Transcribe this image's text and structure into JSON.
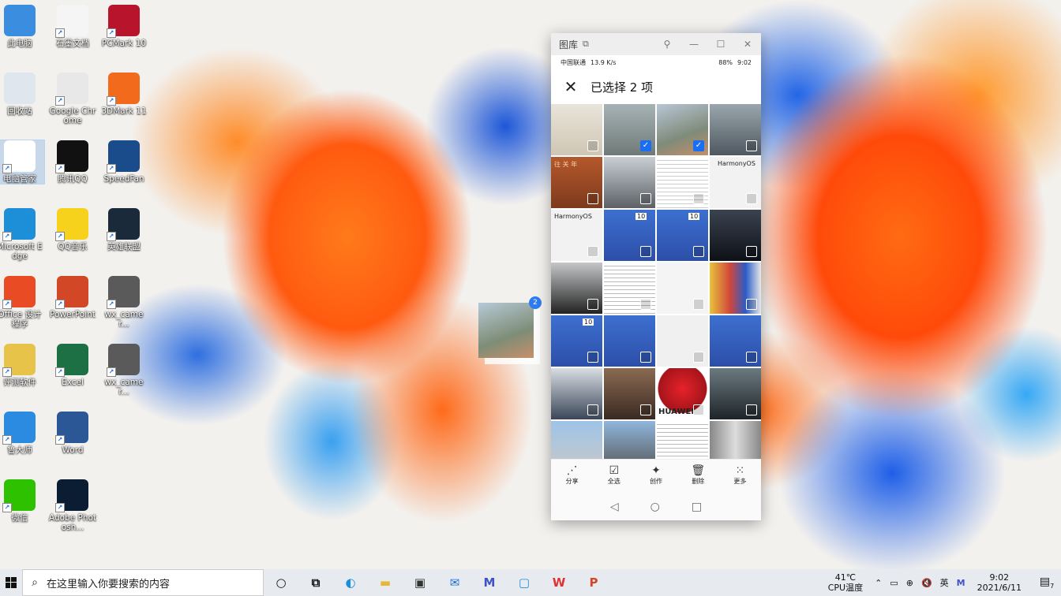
{
  "desktop": {
    "icons": [
      {
        "label": "此电脑",
        "icon": "computer-icon",
        "color": "#3b8de0"
      },
      {
        "label": "石墨文档",
        "icon": "shimo-docs-icon",
        "color": "#f5f5f5"
      },
      {
        "label": "PCMark 10",
        "icon": "pcmark-icon",
        "color": "#b8142b"
      },
      {
        "label": "回收站",
        "icon": "recycle-bin-icon",
        "color": "#dfe6ee"
      },
      {
        "label": "Google Chrome",
        "icon": "chrome-icon",
        "color": "#e8e8e8"
      },
      {
        "label": "3DMark 11",
        "icon": "3dmark-icon",
        "color": "#f26b1d"
      },
      {
        "label": "电脑管家",
        "icon": "pc-manager-icon",
        "color": "#ffffff"
      },
      {
        "label": "腾讯QQ",
        "icon": "qq-icon",
        "color": "#111111"
      },
      {
        "label": "SpeedFan",
        "icon": "speedfan-icon",
        "color": "#1a4b8a"
      },
      {
        "label": "Microsoft Edge",
        "icon": "edge-icon",
        "color": "#1d8fd8"
      },
      {
        "label": "QQ音乐",
        "icon": "qq-music-icon",
        "color": "#f7d21c"
      },
      {
        "label": "英雄联盟",
        "icon": "lol-icon",
        "color": "#1b2a3a"
      },
      {
        "label": "Office 设计 程序",
        "icon": "office-icon",
        "color": "#e94b24"
      },
      {
        "label": "PowerPoint",
        "icon": "powerpoint-icon",
        "color": "#d24726"
      },
      {
        "label": "wx_camer...",
        "icon": "image-file-icon",
        "color": "#5a5a5a"
      },
      {
        "label": "评测软件",
        "icon": "folder-icon",
        "color": "#e8c34a"
      },
      {
        "label": "Excel",
        "icon": "excel-icon",
        "color": "#1d7044"
      },
      {
        "label": "wx_camer...",
        "icon": "image-file-icon",
        "color": "#5a5a5a"
      },
      {
        "label": "鲁大师",
        "icon": "ludashi-icon",
        "color": "#2a8be0"
      },
      {
        "label": "Word",
        "icon": "word-icon",
        "color": "#2b5797"
      },
      {
        "label": "微信",
        "icon": "wechat-icon",
        "color": "#2dc100"
      },
      {
        "label": "Adobe Photosh...",
        "icon": "photoshop-icon",
        "color": "#0b1d33"
      }
    ]
  },
  "gallery_window": {
    "title": "图库",
    "status": {
      "carrier": "中国联通",
      "signal": "13.9 K/s",
      "battery": "88%",
      "time": "9:02"
    },
    "header_title": "已选择 2 项",
    "thumb_texts": {
      "t4": "往 关 年",
      "hm1": "HarmonyOS",
      "hm2": "HarmonyOS",
      "n10": "10",
      "huawei": "HUAWEI"
    },
    "selected_count": 2,
    "toolbar": [
      {
        "label": "分享",
        "icon": "share-icon",
        "glyph": "⋰"
      },
      {
        "label": "全选",
        "icon": "select-all-icon",
        "glyph": "☑"
      },
      {
        "label": "创作",
        "icon": "create-icon",
        "glyph": "✦"
      },
      {
        "label": "删除",
        "icon": "delete-icon",
        "glyph": "🗑"
      },
      {
        "label": "更多",
        "icon": "more-icon",
        "glyph": "⁙"
      }
    ],
    "nav": [
      "◁",
      "○",
      "□"
    ]
  },
  "drag_badge": "2",
  "taskbar": {
    "search_placeholder": "在这里输入你要搜索的内容",
    "apps": [
      "cortana-icon",
      "task-view-icon",
      "edge-icon",
      "file-explorer-icon",
      "store-icon",
      "mail-icon",
      "pc-manager-icon",
      "connect-icon",
      "wps-icon",
      "powerpoint-icon"
    ],
    "cpu_temp": "41℃",
    "cpu_label": "CPU温度",
    "ime": "英",
    "time": "9:02",
    "date": "2021/6/11",
    "notifications": "7"
  },
  "colors": {
    "accent": "#1b6ef3",
    "taskbar": "#e7eaef"
  }
}
